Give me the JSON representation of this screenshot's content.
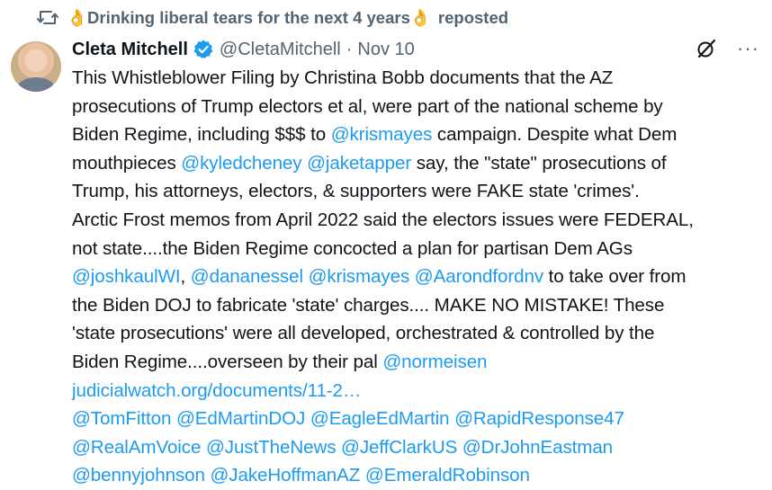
{
  "repost": {
    "reposter_name": "👌Drinking liberal tears for the next 4 years👌",
    "label": "reposted"
  },
  "post": {
    "author_name": "Cleta Mitchell",
    "handle": "@CletaMitchell",
    "separator": "·",
    "date": "Nov 10",
    "more_label": "···",
    "lines": [
      [
        {
          "t": "This Whistleblower Filing by Christina Bobb documents that the AZ"
        }
      ],
      [
        {
          "t": "prosecutions of Trump electors et al, were part of the national scheme by"
        }
      ],
      [
        {
          "t": "Biden Regime, including $$$  to "
        },
        {
          "t": "@krismayes",
          "m": true
        },
        {
          "t": " campaign. Despite what Dem"
        }
      ],
      [
        {
          "t": "mouthpieces "
        },
        {
          "t": "@kyledcheney",
          "m": true
        },
        {
          "t": " "
        },
        {
          "t": "@jaketapper",
          "m": true
        },
        {
          "t": " say, the \"state\" prosecutions of"
        }
      ],
      [
        {
          "t": "Trump, his attorneys, electors, & supporters were FAKE state 'crimes'."
        }
      ],
      [
        {
          "t": "Arctic Frost memos from April 2022 said the electors issues were FEDERAL,"
        }
      ],
      [
        {
          "t": "not state....the Biden Regime concocted a plan for partisan Dem AGs"
        }
      ],
      [
        {
          "t": "@joshkaulWI",
          "m": true
        },
        {
          "t": ", "
        },
        {
          "t": "@dananessel",
          "m": true
        },
        {
          "t": " "
        },
        {
          "t": "@krismayes",
          "m": true
        },
        {
          "t": " "
        },
        {
          "t": "@Aarondfordnv",
          "m": true
        },
        {
          "t": " to take over from"
        }
      ],
      [
        {
          "t": "the Biden DOJ to fabricate 'state' charges.... MAKE NO MISTAKE!  These"
        }
      ],
      [
        {
          "t": "'state prosecutions' were all developed, orchestrated & controlled by the"
        }
      ],
      [
        {
          "t": "Biden Regime....overseen by their pal "
        },
        {
          "t": "@normeisen",
          "m": true
        }
      ],
      [
        {
          "t": "judicialwatch.org/documents/11-2…",
          "m": true
        }
      ],
      [
        {
          "t": "@TomFitton",
          "m": true
        },
        {
          "t": " "
        },
        {
          "t": "@EdMartinDOJ",
          "m": true
        },
        {
          "t": " "
        },
        {
          "t": "@EagleEdMartin",
          "m": true
        },
        {
          "t": " "
        },
        {
          "t": "@RapidResponse47",
          "m": true
        }
      ],
      [
        {
          "t": "@RealAmVoice",
          "m": true
        },
        {
          "t": " "
        },
        {
          "t": "@JustTheNews",
          "m": true
        },
        {
          "t": " "
        },
        {
          "t": "@JeffClarkUS",
          "m": true
        },
        {
          "t": " "
        },
        {
          "t": "@DrJohnEastman",
          "m": true
        }
      ],
      [
        {
          "t": "@bennyjohnson",
          "m": true
        },
        {
          "t": " "
        },
        {
          "t": "@JakeHoffmanAZ",
          "m": true
        },
        {
          "t": " "
        },
        {
          "t": "@EmeraldRobinson",
          "m": true
        }
      ]
    ]
  },
  "icons": {
    "repost": "repost-icon",
    "verified": "verified-badge-icon",
    "grok": "grok-icon",
    "more": "more-icon",
    "avatar": "avatar"
  },
  "colors": {
    "text": "#0f1419",
    "secondary": "#536471",
    "link": "#1d9bf0",
    "verified": "#1d9bf0"
  }
}
